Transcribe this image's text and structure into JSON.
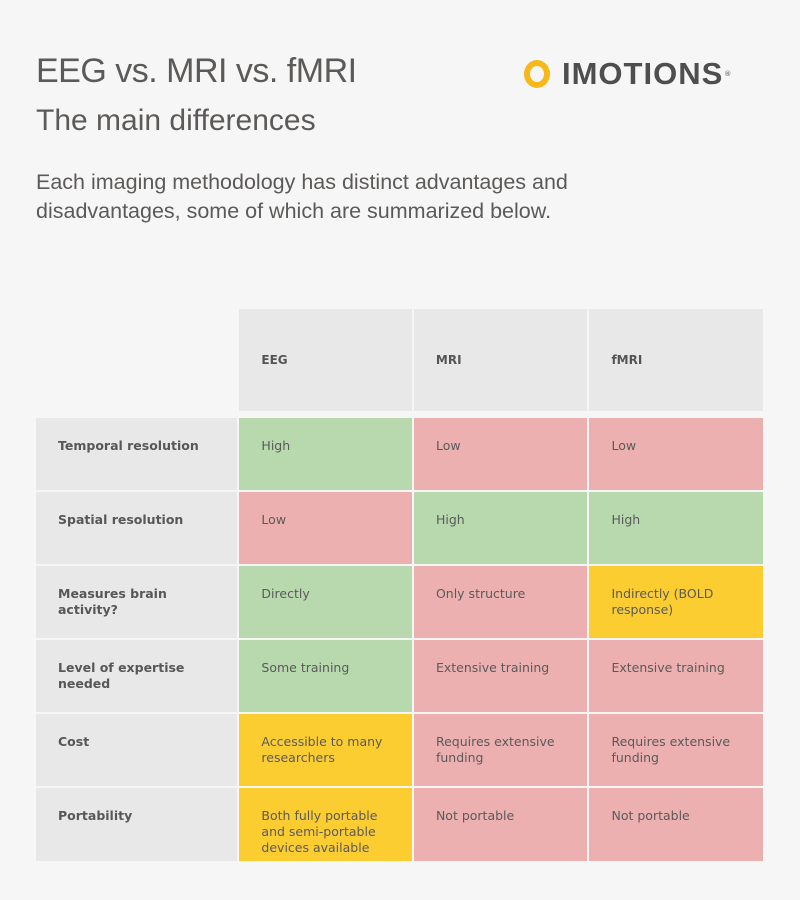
{
  "header": {
    "title": "EEG vs. MRI vs. fMRI",
    "subtitle": "The main differences",
    "intro": "Each imaging methodology has distinct advantages and disadvantages, some of which are summarized below."
  },
  "logo": {
    "icon": "ring-icon",
    "text": "IMOTIONS",
    "registered": "®",
    "ring_color": "#f7b81b"
  },
  "legend_colors": {
    "good": "#b8d8ae",
    "bad": "#edb0b0",
    "mid": "#fbcd31",
    "header": "#e8e8e8"
  },
  "table": {
    "columns": [
      "EEG",
      "MRI",
      "fMRI"
    ],
    "rows": [
      {
        "label": "Temporal resolution",
        "cells": [
          {
            "text": "High",
            "rating": "good"
          },
          {
            "text": "Low",
            "rating": "bad"
          },
          {
            "text": "Low",
            "rating": "bad"
          }
        ]
      },
      {
        "label": "Spatial resolution",
        "cells": [
          {
            "text": "Low",
            "rating": "bad"
          },
          {
            "text": "High",
            "rating": "good"
          },
          {
            "text": "High",
            "rating": "good"
          }
        ]
      },
      {
        "label": "Measures brain activity?",
        "cells": [
          {
            "text": "Directly",
            "rating": "good"
          },
          {
            "text": "Only structure",
            "rating": "bad"
          },
          {
            "text": "Indirectly (BOLD response)",
            "rating": "mid"
          }
        ]
      },
      {
        "label": "Level of expertise needed",
        "cells": [
          {
            "text": "Some training",
            "rating": "good"
          },
          {
            "text": "Extensive training",
            "rating": "bad"
          },
          {
            "text": "Extensive training",
            "rating": "bad"
          }
        ]
      },
      {
        "label": "Cost",
        "cells": [
          {
            "text": "Accessible to many researchers",
            "rating": "mid"
          },
          {
            "text": "Requires extensive funding",
            "rating": "bad"
          },
          {
            "text": "Requires extensive funding",
            "rating": "bad"
          }
        ]
      },
      {
        "label": "Portability",
        "cells": [
          {
            "text": "Both fully portable and semi-portable devices available",
            "rating": "mid"
          },
          {
            "text": "Not portable",
            "rating": "bad"
          },
          {
            "text": "Not portable",
            "rating": "bad"
          }
        ]
      }
    ]
  }
}
